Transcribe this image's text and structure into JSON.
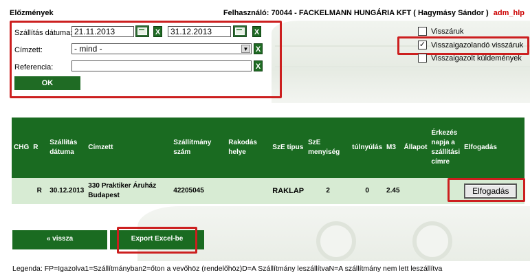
{
  "header": {
    "section_title": "Előzmények",
    "user_label": "Felhasználó: 70044 - FACKELMANN HUNGÁRIA KFT ( Hagymásy Sándor )",
    "help_link": "adm_hlp"
  },
  "filters": {
    "date_label": "Szállítás dátuma:",
    "date_from": "21.11.2013",
    "date_to": "31.12.2013",
    "recipient_label": "Címzett:",
    "recipient_value": "- mind -",
    "reference_label": "Referencia:",
    "reference_value": "",
    "clear_label": "X",
    "ok_label": "OK"
  },
  "options": [
    {
      "label": "Visszáruk",
      "checked": false
    },
    {
      "label": "Visszaigazolandó visszáruk",
      "checked": true
    },
    {
      "label": "Visszaigazolt küldemények",
      "checked": false
    }
  ],
  "table": {
    "headers": [
      "CHG",
      "R",
      "Szállítás dátuma",
      "Címzett",
      "Szállítmány szám",
      "Rakodás helye",
      "SzE típus",
      "SzE menyiség",
      "túlnyúlás",
      "M3",
      "Állapot",
      "Érkezés napja a szállítási címre",
      "Elfogadás"
    ],
    "rows": [
      {
        "chg": "",
        "r": "R",
        "date": "30.12.2013",
        "recipient": "330 Praktiker Áruház Budapest",
        "shipment_no": "42205045",
        "loading_place": "",
        "sze_type": "RAKLAP",
        "sze_qty": "2",
        "overhang": "0",
        "m3": "2.45",
        "status": "",
        "arrival": "",
        "accept_label": "Elfogadás"
      }
    ]
  },
  "actions": {
    "back_label": "« vissza",
    "export_label": "Export Excel-be"
  },
  "legend": "Legenda: FP=Igazolva1=Szállítmányban2=őton a vevőhöz (rendelőhöz)D=A Szállítmány leszállítvaN=A szállítmány nem lett leszállítva",
  "colors": {
    "accent_green": "#1a6b21",
    "row_green": "#d7ebd3",
    "highlight_red": "#cc1f1f",
    "help_red": "#cc0000"
  }
}
